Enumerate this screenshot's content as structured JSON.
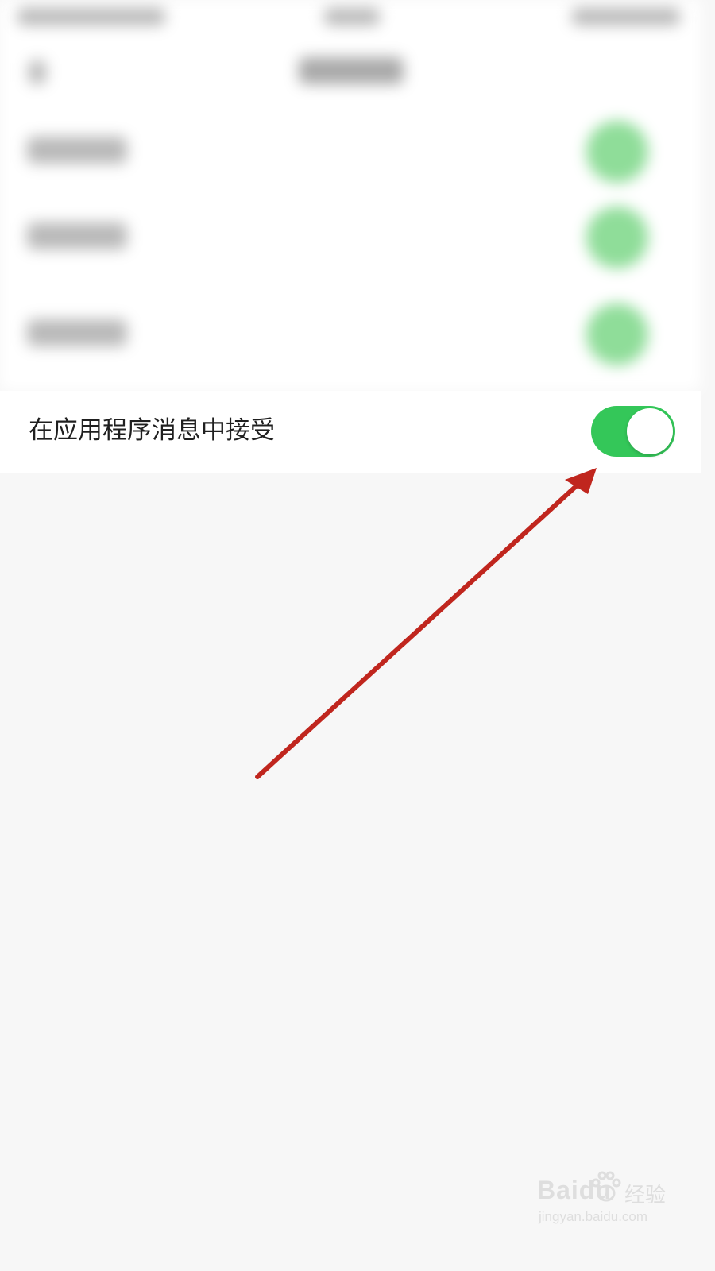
{
  "settings": {
    "focused_row": {
      "label": "在应用程序消息中接受",
      "toggle_state": "on"
    }
  },
  "colors": {
    "toggle_on": "#34c759",
    "arrow": "#c0261e",
    "background": "#f7f7f7"
  },
  "watermark": {
    "brand": "Baidu",
    "brand_cn": "经验",
    "url": "jingyan.baidu.com"
  }
}
